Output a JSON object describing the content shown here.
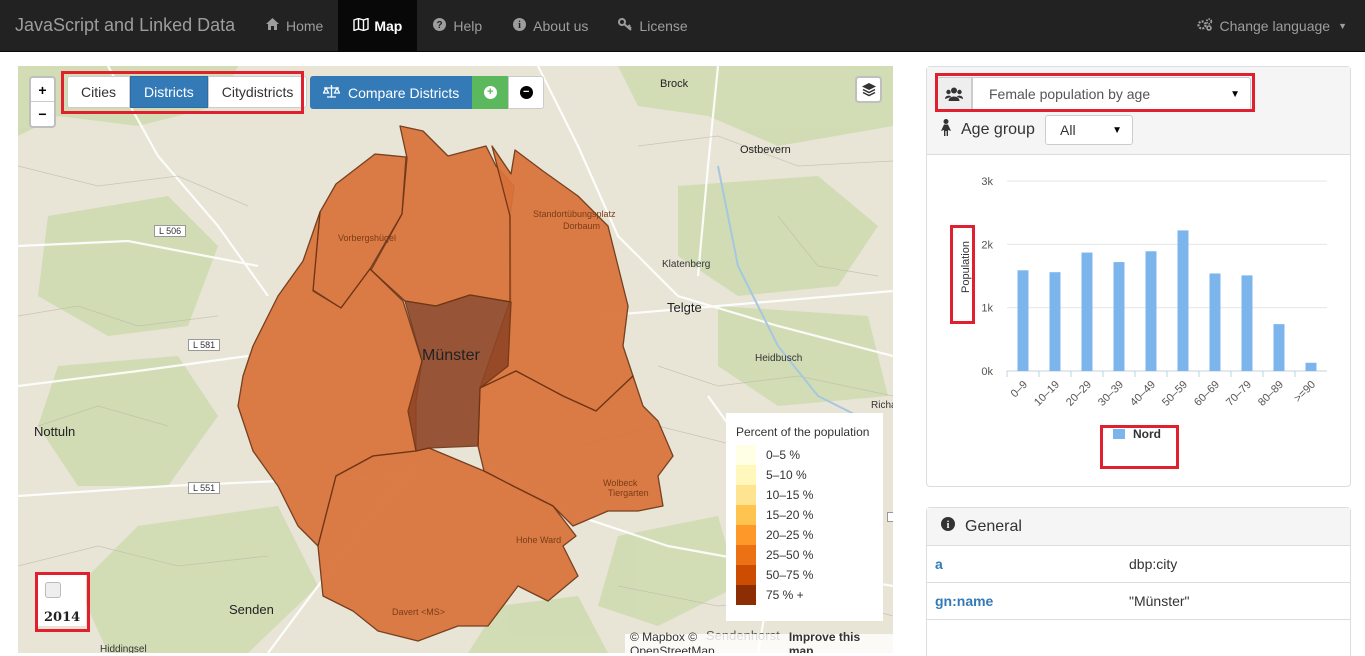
{
  "navbar": {
    "brand": "JavaScript and Linked Data",
    "items": [
      {
        "label": "Home",
        "icon": "home-icon"
      },
      {
        "label": "Map",
        "icon": "map-icon"
      },
      {
        "label": "Help",
        "icon": "question-icon"
      },
      {
        "label": "About us",
        "icon": "info-icon"
      },
      {
        "label": "License",
        "icon": "key-icon"
      }
    ],
    "active": "Map",
    "language": "Change language"
  },
  "map": {
    "zoom_in": "+",
    "zoom_out": "−",
    "levels": [
      "Cities",
      "Districts",
      "Citydistricts"
    ],
    "active_level": "Districts",
    "compare_label": "Compare Districts",
    "city_label": "Münster",
    "places": {
      "brock": "Brock",
      "ostbevern": "Ostbevern",
      "telgte": "Telgte",
      "klatenberg": "Klatenberg",
      "heidbusch": "Heidbusch",
      "nottuln": "Nottuln",
      "senden": "Senden",
      "sendenhorst": "Sendenhorst",
      "richa": "Richa",
      "hiddingsel": "Hiddingsel"
    },
    "districts": {
      "vorbergshuegel": "Vorbergshügel",
      "standort1": "Standortübungsplatz",
      "standort2": "Dorbaum",
      "wolbeck1": "Wolbeck",
      "wolbeck2": "Tiergarten",
      "hohe_ward": "Hohe Ward",
      "davert": "Davert <MS>"
    },
    "roads": {
      "l506": "L 506",
      "l581": "L 581",
      "l551": "L 551"
    },
    "legend": {
      "title": "Percent of the population",
      "items": [
        {
          "label": "0–5 %",
          "color": "#ffffe5"
        },
        {
          "label": "5–10 %",
          "color": "#fff7bc"
        },
        {
          "label": "10–15 %",
          "color": "#fee391"
        },
        {
          "label": "15–20 %",
          "color": "#fec44f"
        },
        {
          "label": "20–25 %",
          "color": "#fe9929"
        },
        {
          "label": "25–50 %",
          "color": "#ec7014"
        },
        {
          "label": "50–75 %",
          "color": "#cc4c02"
        },
        {
          "label": "75 % +",
          "color": "#8c2d04"
        }
      ]
    },
    "year": "2014",
    "attribution": "© Mapbox © OpenStreetMap",
    "improve": "Improve this map"
  },
  "stats": {
    "dataset": "Female population by age",
    "age_group_label": "Age group",
    "age_group_value": "All"
  },
  "chart_data": {
    "type": "bar",
    "categories": [
      "0–9",
      "10–19",
      "20–29",
      "30–39",
      "40–49",
      "50–59",
      "60–69",
      "70–79",
      "80–89",
      ">=90"
    ],
    "series": [
      {
        "name": "Nord",
        "values": [
          1590,
          1560,
          1870,
          1720,
          1890,
          2220,
          1540,
          1510,
          740,
          130
        ],
        "color": "#7cb5ec"
      }
    ],
    "ylabel": "Population",
    "ylim": [
      0,
      3000
    ],
    "yticks": [
      "0k",
      "1k",
      "2k",
      "3k"
    ]
  },
  "general": {
    "title": "General",
    "rows": [
      {
        "key": "a",
        "value": "dbp:city"
      },
      {
        "key": "gn:name",
        "value": "\"Münster\""
      }
    ]
  }
}
